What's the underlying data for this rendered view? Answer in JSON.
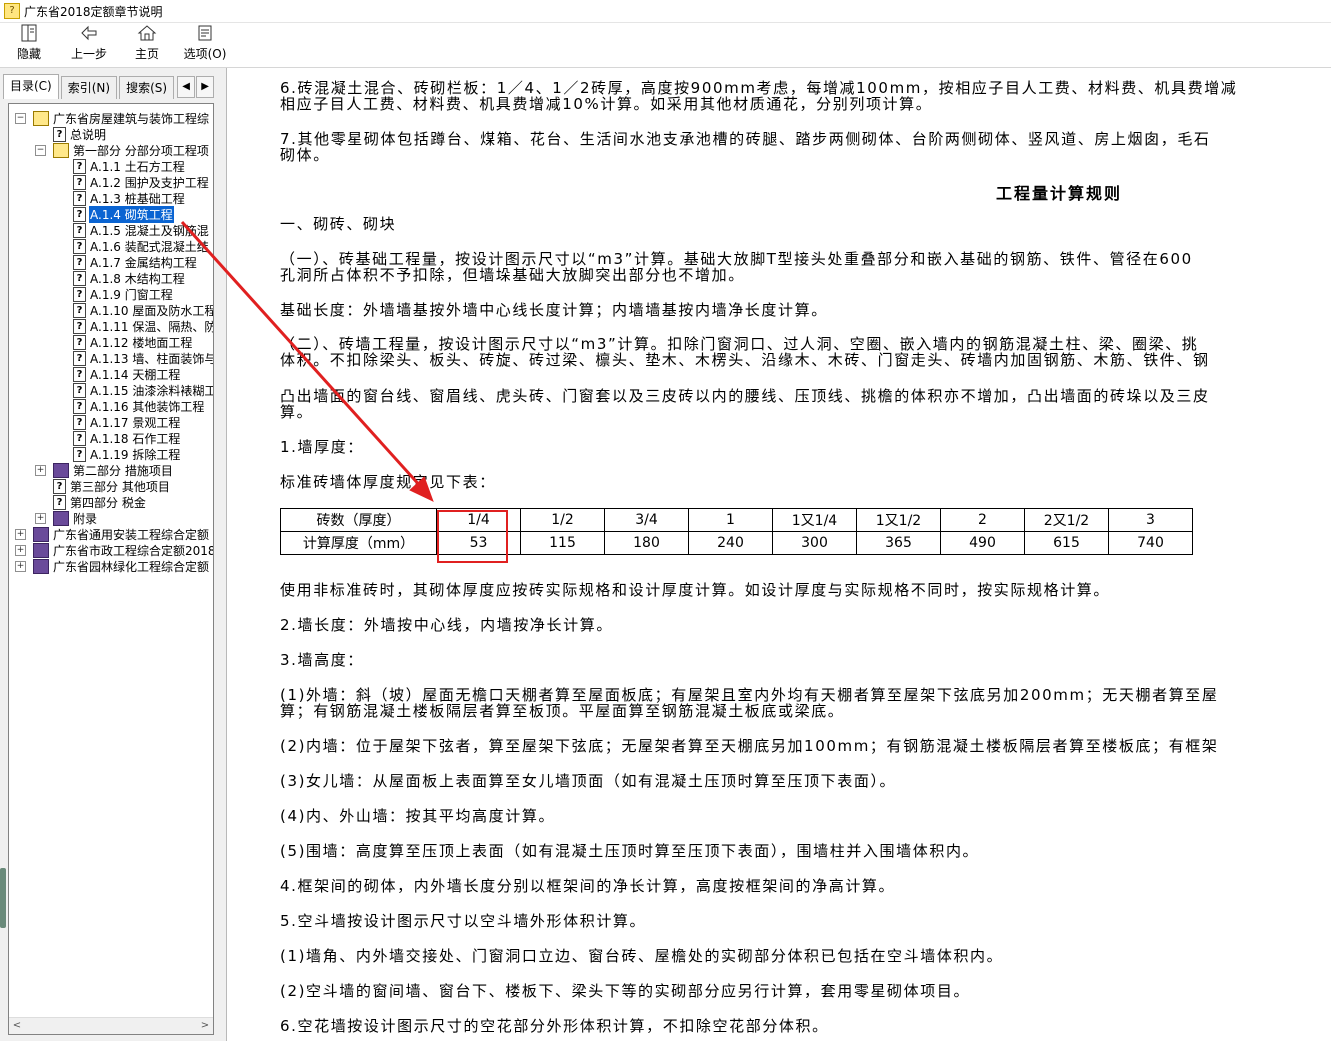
{
  "window": {
    "title": "广东省2018定额章节说明"
  },
  "toolbar": {
    "buttons": [
      {
        "label": "隐藏",
        "icon": "hide-icon"
      },
      {
        "label": "上一步",
        "icon": "back-arrow-icon"
      },
      {
        "label": "主页",
        "icon": "home-icon"
      },
      {
        "label": "选项(O)",
        "icon": "options-icon"
      }
    ]
  },
  "tabs": [
    {
      "label": "目录(C)",
      "active": true
    },
    {
      "label": "索引(N)",
      "active": false
    },
    {
      "label": "搜索(S)",
      "active": false
    }
  ],
  "tree": [
    {
      "level": 0,
      "type": "book-open",
      "expander": "−",
      "label": "广东省房屋建筑与装饰工程综"
    },
    {
      "level": 1,
      "type": "page",
      "expander": "",
      "label": "总说明"
    },
    {
      "level": 1,
      "type": "book-open",
      "expander": "−",
      "label": "第一部分 分部分项工程项"
    },
    {
      "level": 2,
      "type": "page",
      "expander": "",
      "label": "A.1.1 土石方工程"
    },
    {
      "level": 2,
      "type": "page",
      "expander": "",
      "label": "A.1.2 围护及支护工程"
    },
    {
      "level": 2,
      "type": "page",
      "expander": "",
      "label": "A.1.3 桩基础工程"
    },
    {
      "level": 2,
      "type": "page",
      "expander": "",
      "label": "A.1.4 砌筑工程",
      "selected": true
    },
    {
      "level": 2,
      "type": "page",
      "expander": "",
      "label": "A.1.5 混凝土及钢筋混"
    },
    {
      "level": 2,
      "type": "page",
      "expander": "",
      "label": "A.1.6 装配式混凝土结"
    },
    {
      "level": 2,
      "type": "page",
      "expander": "",
      "label": "A.1.7 金属结构工程"
    },
    {
      "level": 2,
      "type": "page",
      "expander": "",
      "label": "A.1.8 木结构工程"
    },
    {
      "level": 2,
      "type": "page",
      "expander": "",
      "label": "A.1.9 门窗工程"
    },
    {
      "level": 2,
      "type": "page",
      "expander": "",
      "label": "A.1.10 屋面及防水工程"
    },
    {
      "level": 2,
      "type": "page",
      "expander": "",
      "label": "A.1.11 保温、隔热、防"
    },
    {
      "level": 2,
      "type": "page",
      "expander": "",
      "label": "A.1.12 楼地面工程"
    },
    {
      "level": 2,
      "type": "page",
      "expander": "",
      "label": "A.1.13 墙、柱面装饰与"
    },
    {
      "level": 2,
      "type": "page",
      "expander": "",
      "label": "A.1.14 天棚工程"
    },
    {
      "level": 2,
      "type": "page",
      "expander": "",
      "label": "A.1.15 油漆涂料裱糊工"
    },
    {
      "level": 2,
      "type": "page",
      "expander": "",
      "label": "A.1.16 其他装饰工程"
    },
    {
      "level": 2,
      "type": "page",
      "expander": "",
      "label": "A.1.17 景观工程"
    },
    {
      "level": 2,
      "type": "page",
      "expander": "",
      "label": "A.1.18 石作工程"
    },
    {
      "level": 2,
      "type": "page",
      "expander": "",
      "label": "A.1.19 拆除工程"
    },
    {
      "level": 1,
      "type": "book",
      "expander": "+",
      "label": "第二部分 措施项目"
    },
    {
      "level": 1,
      "type": "page",
      "expander": "",
      "label": "第三部分 其他项目"
    },
    {
      "level": 1,
      "type": "page",
      "expander": "",
      "label": "第四部分 税金"
    },
    {
      "level": 1,
      "type": "book",
      "expander": "+",
      "label": "附录"
    },
    {
      "level": 0,
      "type": "book",
      "expander": "+",
      "label": "广东省通用安装工程综合定额"
    },
    {
      "level": 0,
      "type": "book",
      "expander": "+",
      "label": "广东省市政工程综合定额2018"
    },
    {
      "level": 0,
      "type": "book",
      "expander": "+",
      "label": "广东省园林绿化工程综合定额"
    }
  ],
  "content": {
    "paragraphs_top": [
      "6.砖混凝土混合、砖砌栏板：1／4、1／2砖厚，高度按900mm考虑，每增减100mm，按相应子目人工费、材料费、机具费增减",
      "相应子目人工费、材料费、机具费增减10%计算。如采用其他材质通花，分别列项计算。",
      "7.其他零星砌体包括蹲台、煤箱、花台、生活间水池支承池槽的砖腿、踏步两侧砌体、台阶两侧砌体、竖风道、房上烟囱，毛石",
      "砌体。"
    ],
    "heading": "工程量计算规则",
    "paragraphs_mid": [
      "一、砌砖、砌块",
      "（一）、砖基础工程量，按设计图示尺寸以“m3”计算。基础大放脚T型接头处重叠部分和嵌入基础的钢筋、铁件、管径在600",
      "孔洞所占体积不予扣除，但墙垛基础大放脚突出部分也不增加。",
      "基础长度：外墙墙基按外墙中心线长度计算；内墙墙基按内墙净长度计算。",
      "（二）、砖墙工程量，按设计图示尺寸以“m3”计算。扣除门窗洞口、过人洞、空圈、嵌入墙内的钢筋混凝土柱、梁、圈梁、挑",
      "体积。不扣除梁头、板头、砖旋、砖过梁、檩头、垫木、木楞头、沿缘木、木砖、门窗走头、砖墙内加固钢筋、木筋、铁件、钢",
      "凸出墙面的窗台线、窗眉线、虎头砖、门窗套以及三皮砖以内的腰线、压顶线、挑檐的体积亦不增加，凸出墙面的砖垛以及三皮",
      "算。",
      "1.墙厚度：",
      "标准砖墙体厚度规定见下表："
    ],
    "table": {
      "row1_header": "砖数（厚度）",
      "row2_header": "计算厚度（mm）",
      "bricks": [
        "1/4",
        "1/2",
        "3/4",
        "1",
        "1又1/4",
        "1又1/2",
        "2",
        "2又1/2",
        "3"
      ],
      "thickness": [
        "53",
        "115",
        "180",
        "240",
        "300",
        "365",
        "490",
        "615",
        "740"
      ]
    },
    "paragraphs_bottom": [
      "使用非标准砖时，其砌体厚度应按砖实际规格和设计厚度计算。如设计厚度与实际规格不同时，按实际规格计算。",
      "2.墙长度：外墙按中心线，内墙按净长计算。",
      "3.墙高度：",
      "(1)外墙：斜（坡）屋面无檐口天棚者算至屋面板底；有屋架且室内外均有天棚者算至屋架下弦底另加200mm；无天棚者算至屋",
      "算；有钢筋混凝土楼板隔层者算至板顶。平屋面算至钢筋混凝土板底或梁底。",
      "(2)内墙：位于屋架下弦者，算至屋架下弦底；无屋架者算至天棚底另加100mm；有钢筋混凝土楼板隔层者算至楼板底；有框架",
      "(3)女儿墙：从屋面板上表面算至女儿墙顶面（如有混凝土压顶时算至压顶下表面）。",
      "(4)内、外山墙：按其平均高度计算。",
      "(5)围墙：高度算至压顶上表面（如有混凝土压顶时算至压顶下表面），围墙柱并入围墙体积内。",
      "4.框架间的砌体，内外墙长度分别以框架间的净长计算，高度按框架间的净高计算。",
      "5.空斗墙按设计图示尺寸以空斗墙外形体积计算。",
      "(1)墙角、内外墙交接处、门窗洞口立边、窗台砖、屋檐处的实砌部分体积已包括在空斗墙体积内。",
      "(2)空斗墙的窗间墙、窗台下、楼板下、梁头下等的实砌部分应另行计算，套用零星砌体项目。",
      "6.空花墙按设计图示尺寸的空花部分外形体积计算，不扣除空花部分体积。"
    ]
  },
  "annotation": {
    "color": "#e02020"
  }
}
